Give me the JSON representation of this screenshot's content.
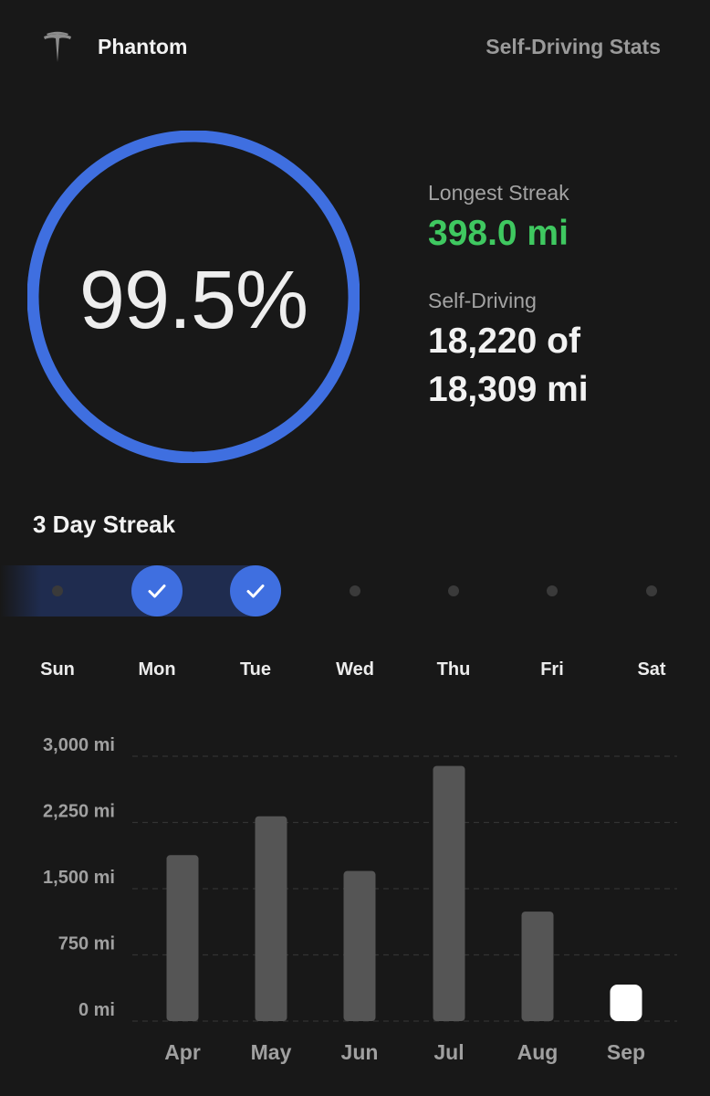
{
  "header": {
    "car_name": "Phantom",
    "page_title": "Self-Driving Stats",
    "logo_icon": "tesla-logo-icon"
  },
  "summary": {
    "percent_text": "99.5%",
    "percent_value": 99.5,
    "longest_streak_label": "Longest Streak",
    "longest_streak_value": "398.0 mi",
    "self_driving_label": "Self-Driving",
    "self_driving_line1": "18,220 of",
    "self_driving_line2": "18,309 mi"
  },
  "streak": {
    "title": "3 Day Streak",
    "days": [
      {
        "label": "Sun",
        "completed": false
      },
      {
        "label": "Mon",
        "completed": true
      },
      {
        "label": "Tue",
        "completed": true
      },
      {
        "label": "Wed",
        "completed": false
      },
      {
        "label": "Thu",
        "completed": false
      },
      {
        "label": "Fri",
        "completed": false
      },
      {
        "label": "Sat",
        "completed": false
      }
    ]
  },
  "colors": {
    "ring": "#3f6fe0",
    "accent_green": "#3fc860",
    "bar": "#555555",
    "bar_current": "#ffffff",
    "background": "#181818"
  },
  "chart_data": {
    "type": "bar",
    "categories": [
      "Apr",
      "May",
      "Jun",
      "Jul",
      "Aug",
      "Sep"
    ],
    "values": [
      1880,
      2320,
      1700,
      2890,
      1240,
      60
    ],
    "ylim": [
      0,
      3000
    ],
    "yticks": [
      0,
      750,
      1500,
      2250,
      3000
    ],
    "ytick_labels": [
      "0 mi",
      "750 mi",
      "1,500 mi",
      "2,250 mi",
      "3,000 mi"
    ],
    "highlight": "Sep",
    "grid": true
  }
}
